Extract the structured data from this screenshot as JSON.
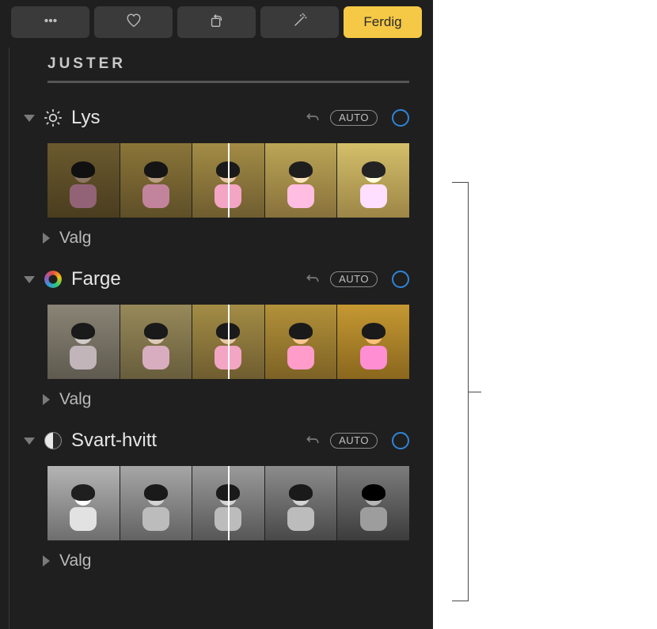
{
  "toolbar": {
    "done_label": "Ferdig"
  },
  "adjust_header": "JUSTER",
  "sections": [
    {
      "id": "light",
      "title": "Lys",
      "auto_label": "AUTO",
      "options_label": "Valg"
    },
    {
      "id": "color",
      "title": "Farge",
      "auto_label": "AUTO",
      "options_label": "Valg"
    },
    {
      "id": "bw",
      "title": "Svart-hvitt",
      "auto_label": "AUTO",
      "options_label": "Valg"
    }
  ]
}
